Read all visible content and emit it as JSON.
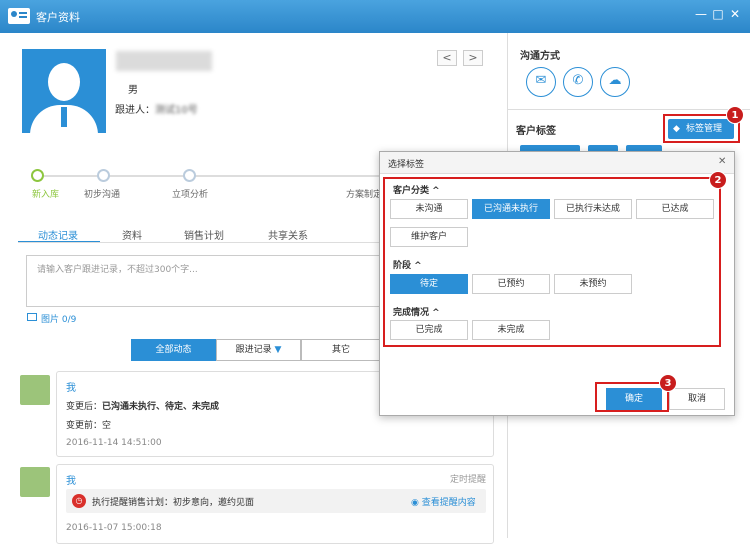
{
  "window": {
    "title": "客户资料",
    "minimize": "—",
    "maximize": "□",
    "close": "✕"
  },
  "customer": {
    "gender": "男",
    "follower_label": "跟进人：",
    "follower_value": "测试10号"
  },
  "nav": {
    "prev": "<",
    "next": ">"
  },
  "steps": [
    "新入库",
    "初步沟通",
    "立项分析",
    "方案制定"
  ],
  "tabs": [
    "动态记录",
    "资料",
    "销售计划",
    "共享关系"
  ],
  "record": {
    "placeholder": "请输入客户跟进记录，不超过300个字...",
    "image_label": "图片 0/9"
  },
  "filters": {
    "all": "全部动态",
    "follow": "跟进记录",
    "other": "其它"
  },
  "feed": [
    {
      "name": "我",
      "line1_label": "变更后：",
      "line1_value": "已沟通未执行、待定、未完成",
      "line2_label": "变更前：",
      "line2_value": "空",
      "time": "2016-11-14 14:51:00"
    },
    {
      "name": "我",
      "tag": "定时提醒",
      "reminder": "执行提醒销售计划：初步意向，邀约见面",
      "link": "查看提醒内容",
      "time": "2016-11-07 15:00:18"
    }
  ],
  "right": {
    "contact_title": "沟通方式",
    "tags_title": "客户标签",
    "tag_manage": "标签管理"
  },
  "dialog": {
    "title": "选择标签",
    "close": "✕",
    "section1": "客户分类 ^",
    "cat": [
      "未沟通",
      "已沟通未执行",
      "已执行未达成",
      "已达成",
      "维护客户"
    ],
    "section2": "阶段 ^",
    "stage": [
      "待定",
      "已预约",
      "未预约"
    ],
    "section3": "完成情况 ^",
    "done": [
      "已完成",
      "未完成"
    ],
    "ok": "确定",
    "cancel": "取消"
  },
  "badges": [
    "1",
    "2",
    "3"
  ],
  "colors": {
    "accent": "#2b8fd6",
    "annotation": "#d71e1e"
  }
}
